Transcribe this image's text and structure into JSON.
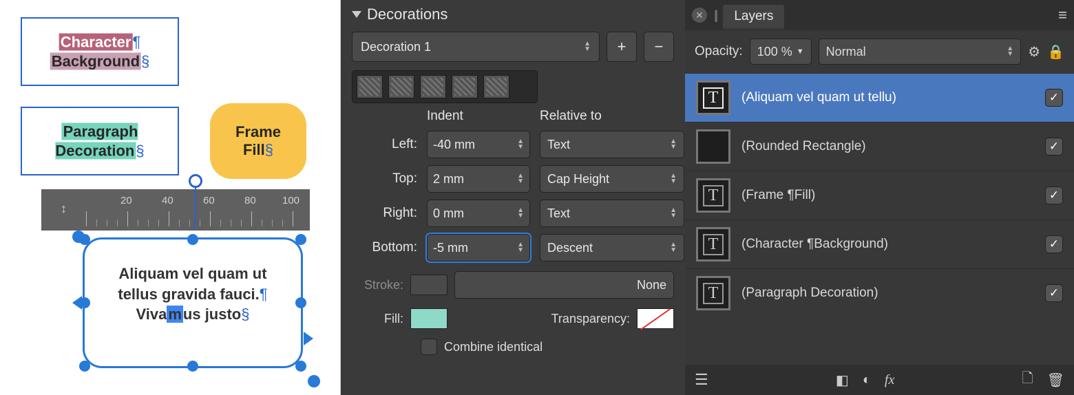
{
  "canvas": {
    "char_label": "Character",
    "bg_label": "Background",
    "para_deco": "Paragraph\nDecoration",
    "frame_fill": "Frame\nFill",
    "textA": "Aliquam vel quam ut",
    "textB": "tellus gravida fauci.",
    "textC_pre": "Viva",
    "textC_sel": "m",
    "textC_post": "us justo",
    "ruler": {
      "ticks": [
        "20",
        "40",
        "60",
        "80",
        "100"
      ]
    }
  },
  "deco": {
    "title": "Decorations",
    "current": "Decoration 1",
    "indent_h": "Indent",
    "relative_h": "Relative to",
    "left_l": "Left:",
    "left_v": "-40 mm",
    "left_rel": "Text",
    "top_l": "Top:",
    "top_v": "2 mm",
    "top_rel": "Cap Height",
    "right_l": "Right:",
    "right_v": "0 mm",
    "right_rel": "Text",
    "bottom_l": "Bottom:",
    "bottom_v": "-5 mm",
    "bottom_rel": "Descent",
    "stroke_l": "Stroke:",
    "none_l": "None",
    "fill_l": "Fill:",
    "trans_l": "Transparency:",
    "combine_l": "Combine identical",
    "colors": {
      "fill": "#8fd9c8"
    }
  },
  "layers": {
    "tab": "Layers",
    "opacity_l": "Opacity:",
    "opacity_v": "100 %",
    "blend": "Normal",
    "items": [
      {
        "name": "(Aliquam vel quam ut tellu)",
        "kind": "text",
        "selected": true,
        "visible": true
      },
      {
        "name": "(Rounded Rectangle)",
        "kind": "shape",
        "selected": false,
        "visible": true
      },
      {
        "name": "(Frame ¶Fill)",
        "kind": "text",
        "selected": false,
        "visible": true
      },
      {
        "name": "(Character  ¶Background)",
        "kind": "text",
        "selected": false,
        "visible": true
      },
      {
        "name": "(Paragraph Decoration)",
        "kind": "text",
        "selected": false,
        "visible": true
      }
    ]
  }
}
